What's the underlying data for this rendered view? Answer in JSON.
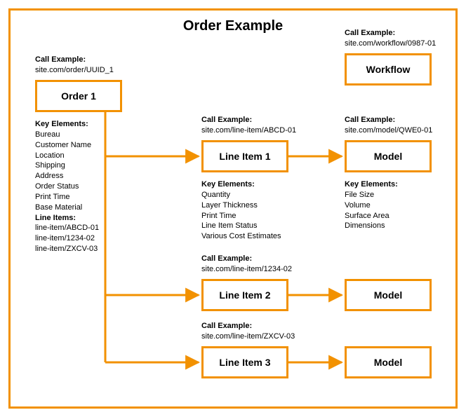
{
  "title": "Order Example",
  "boxes": {
    "order": {
      "label": "Order 1",
      "call_hdr": "Call Example:",
      "call": "site.com/order/UUID_1"
    },
    "workflow": {
      "label": "Workflow",
      "call_hdr": "Call Example:",
      "call": "site.com/workflow/0987-01"
    },
    "lineitem1": {
      "label": "Line Item 1",
      "call_hdr": "Call Example:",
      "call": "site.com/line-item/ABCD-01"
    },
    "model1": {
      "label": "Model",
      "call_hdr": "Call Example:",
      "call": "site.com/model/QWE0-01"
    },
    "lineitem2": {
      "label": "Line Item 2",
      "call_hdr": "Call Example:",
      "call": "site.com/line-item/1234-02"
    },
    "model2": {
      "label": "Model"
    },
    "lineitem3": {
      "label": "Line Item 3",
      "call_hdr": "Call Example:",
      "call": "site.com/line-item/ZXCV-03"
    },
    "model3": {
      "label": "Model"
    }
  },
  "order_key": {
    "hdr": "Key Elements:",
    "e0": "Bureau",
    "e1": "Customer Name",
    "e2": "Location",
    "e3": "Shipping",
    "e4": "Address",
    "e5": "Order Status",
    "e6": "Print Time",
    "e7": "Base Material",
    "items_hdr": "Line Items:",
    "i0": "line-item/ABCD-01",
    "i1": "line-item/1234-02",
    "i2": "line-item/ZXCV-03"
  },
  "lineitem_key": {
    "hdr": "Key Elements:",
    "e0": "Quantity",
    "e1": "Layer Thickness",
    "e2": "Print Time",
    "e3": "Line Item Status",
    "e4": "Various Cost Estimates"
  },
  "model_key": {
    "hdr": "Key Elements:",
    "e0": "File Size",
    "e1": "Volume",
    "e2": "Surface Area",
    "e3": "Dimensions"
  }
}
